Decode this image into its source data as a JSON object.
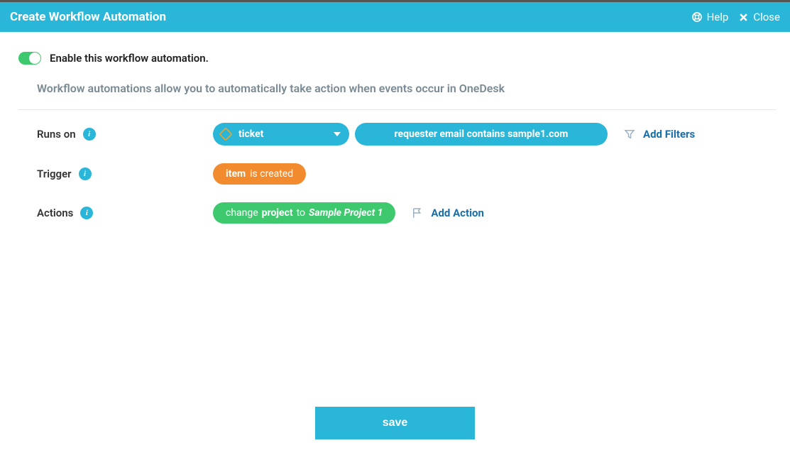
{
  "header": {
    "title": "Create Workflow Automation",
    "help": "Help",
    "close": "Close"
  },
  "enable": {
    "label": "Enable this workflow automation."
  },
  "description": "Workflow automations allow you to automatically take action when events occur in OneDesk",
  "rows": {
    "runs_on": {
      "label": "Runs on",
      "type_label": "ticket",
      "filter_text": "requester email contains sample1.com",
      "add_filters": "Add Filters"
    },
    "trigger": {
      "label": "Trigger",
      "item": "item",
      "is_created": "is created"
    },
    "actions": {
      "label": "Actions",
      "change": "change",
      "project": "project",
      "to": "to",
      "value": "Sample Project 1",
      "add_action": "Add Action"
    }
  },
  "save": "save"
}
